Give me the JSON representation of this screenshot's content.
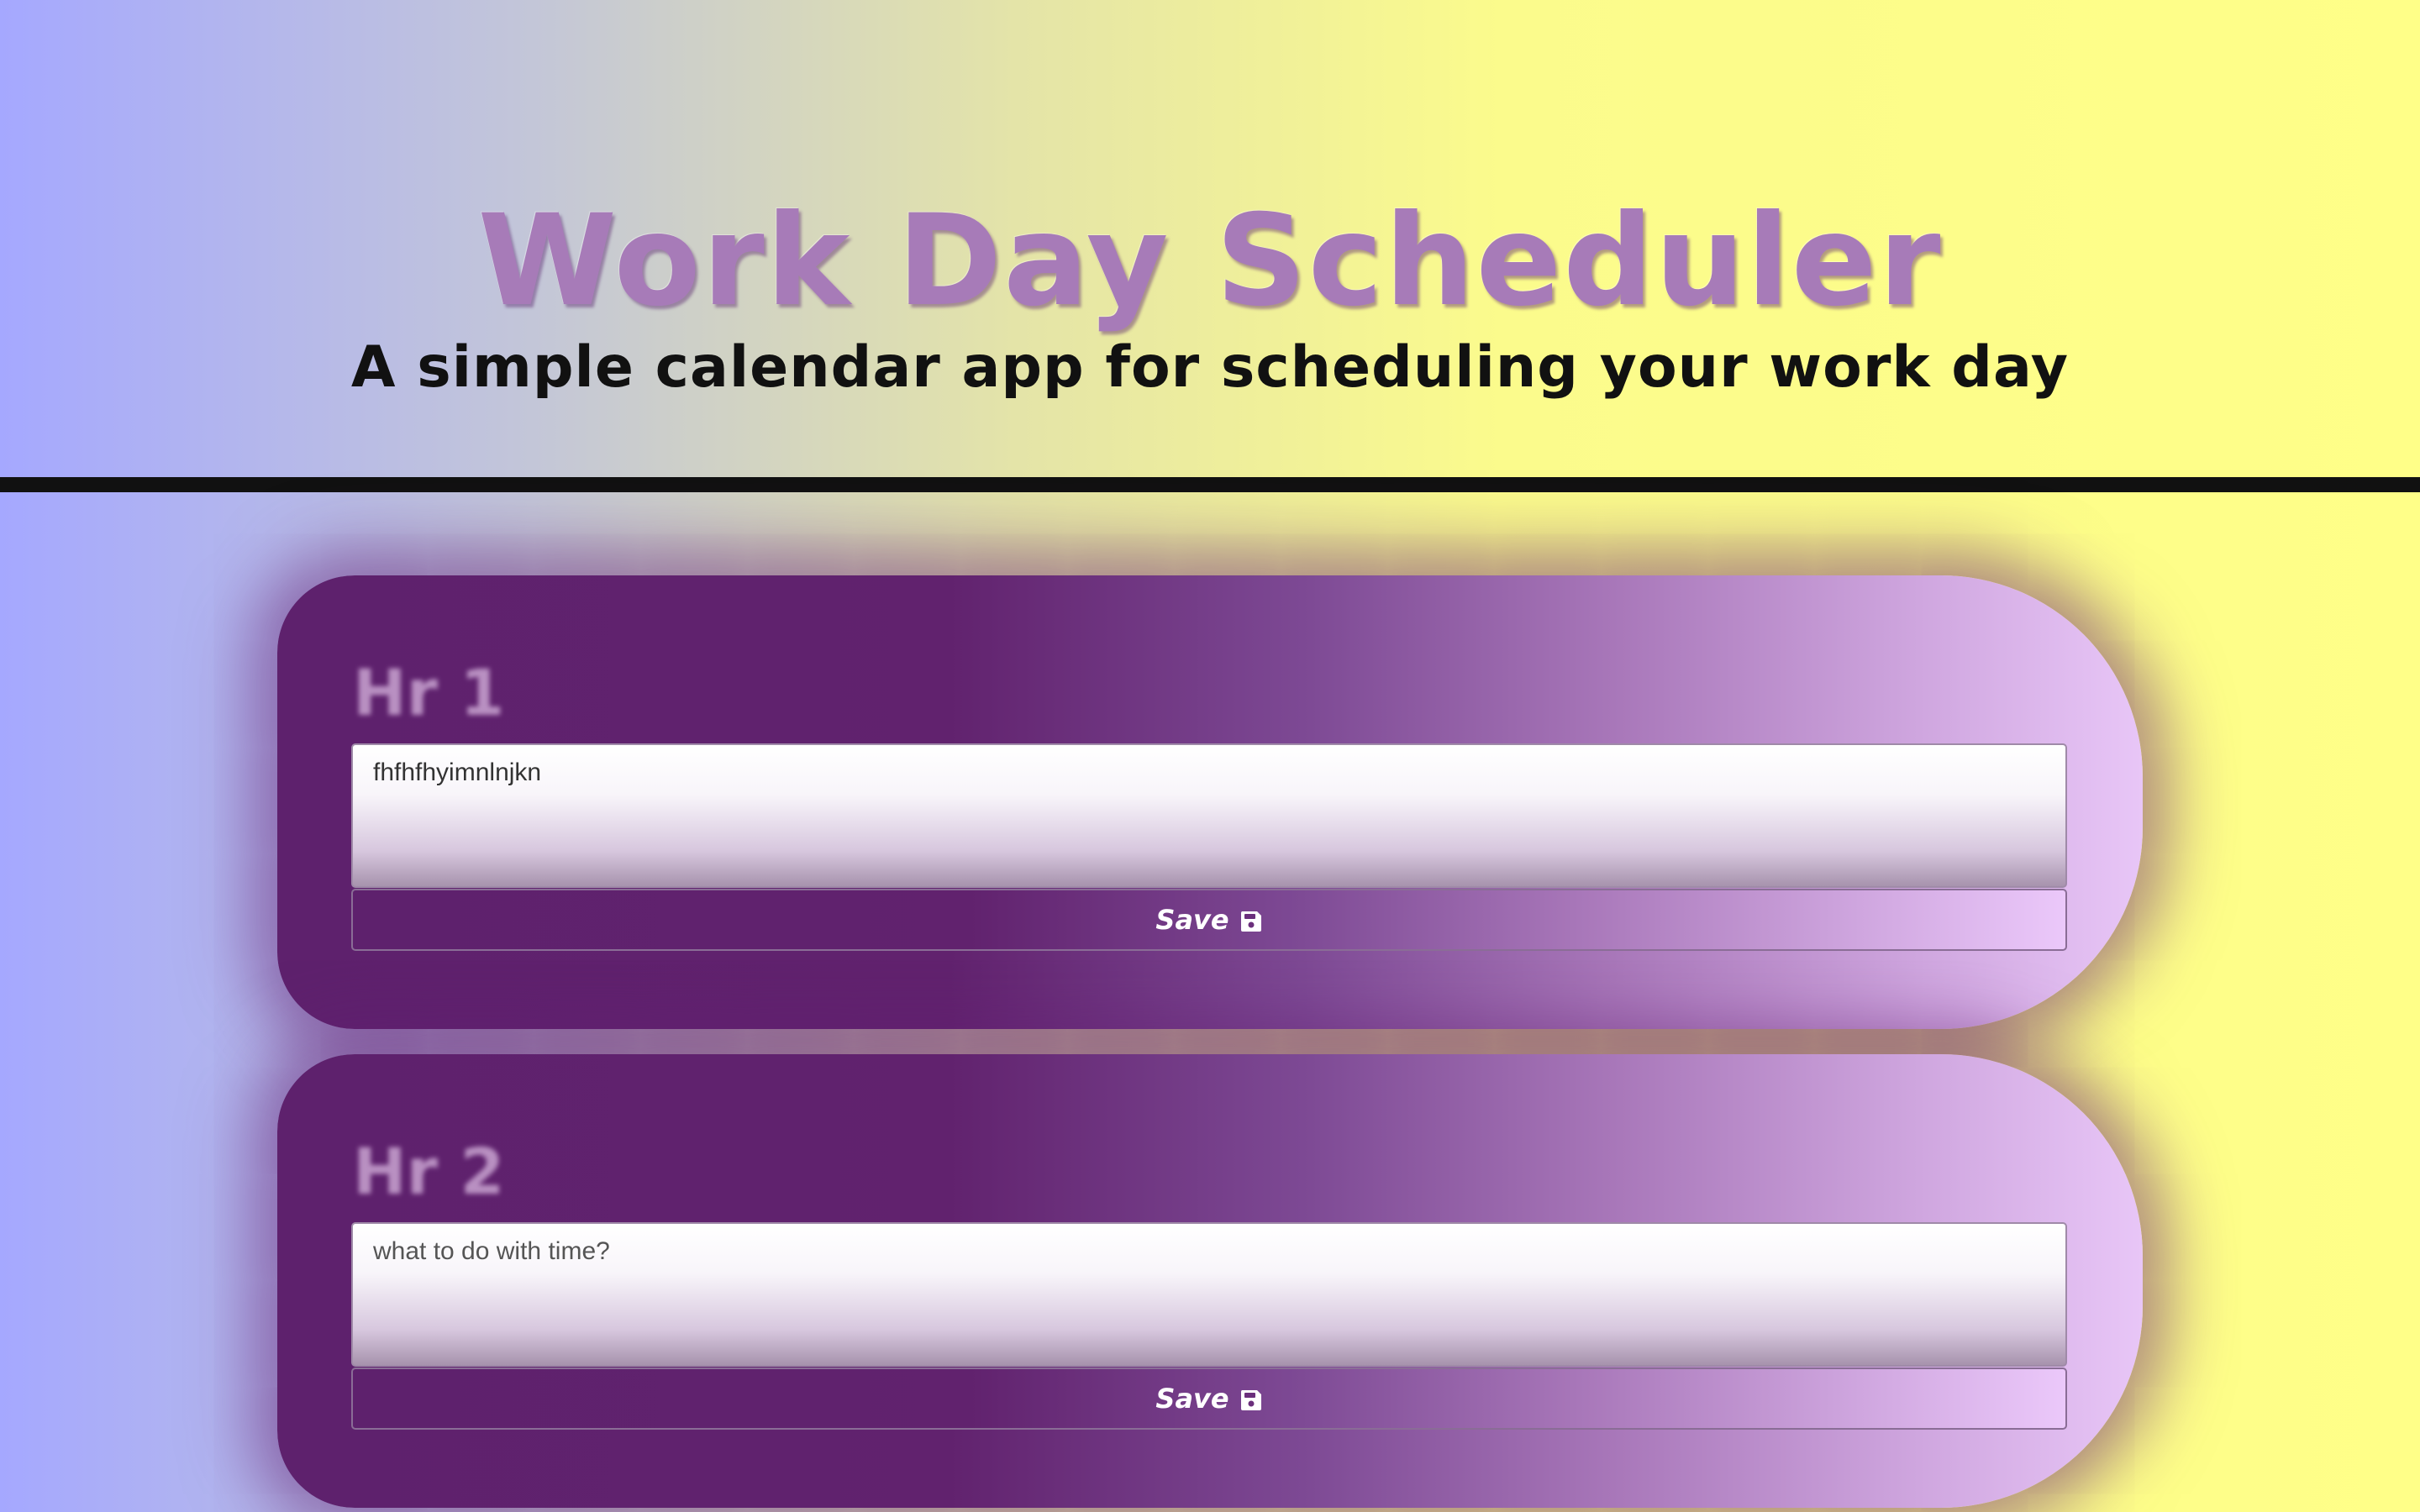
{
  "header": {
    "title": "Work Day Scheduler",
    "subtitle": "A simple calendar app for scheduling your work day"
  },
  "hours": [
    {
      "label": "Hr 1",
      "value": "fhfhfhyimnlnjkn",
      "placeholder": "",
      "save_label": "Save",
      "save_icon": "floppy-disk-icon"
    },
    {
      "label": "Hr 2",
      "value": "",
      "placeholder": "what to do with time?",
      "save_label": "Save",
      "save_icon": "floppy-disk-icon"
    }
  ],
  "colors": {
    "title": "#a77bb8",
    "block_dark": "#5e216d",
    "block_light": "#e8c6f7",
    "bg_left": "#a5a8ff",
    "bg_right": "#ffff88",
    "divider": "#111111"
  }
}
